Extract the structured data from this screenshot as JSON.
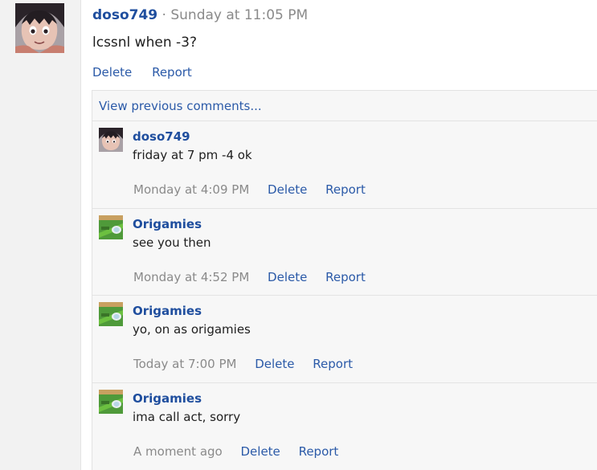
{
  "post": {
    "author": "doso749",
    "separator": "·",
    "time": "Sunday at 11:05 PM",
    "text": "lcssnl when -3?",
    "delete_label": "Delete",
    "report_label": "Report"
  },
  "comments_section": {
    "view_previous_label": "View previous comments...",
    "comments": [
      {
        "author": "doso749",
        "text": "friday at 7 pm -4 ok",
        "time": "Monday at 4:09 PM",
        "delete_label": "Delete",
        "report_label": "Report"
      },
      {
        "author": "Origamies",
        "text": "see you then",
        "time": "Monday at 4:52 PM",
        "delete_label": "Delete",
        "report_label": "Report"
      },
      {
        "author": "Origamies",
        "text": "yo, on as origamies",
        "time": "Today at 7:00 PM",
        "delete_label": "Delete",
        "report_label": "Report"
      },
      {
        "author": "Origamies",
        "text": "ima call act, sorry",
        "time": "A moment ago",
        "delete_label": "Delete",
        "report_label": "Report"
      }
    ]
  },
  "colors": {
    "link": "#2b5aa8",
    "author": "#1f4e9e",
    "muted": "#8a8a8a",
    "panel": "#f7f7f7"
  },
  "icons": {
    "doso749_avatar": "anime-character-avatar",
    "origamies_avatar": "green-game-avatar"
  }
}
